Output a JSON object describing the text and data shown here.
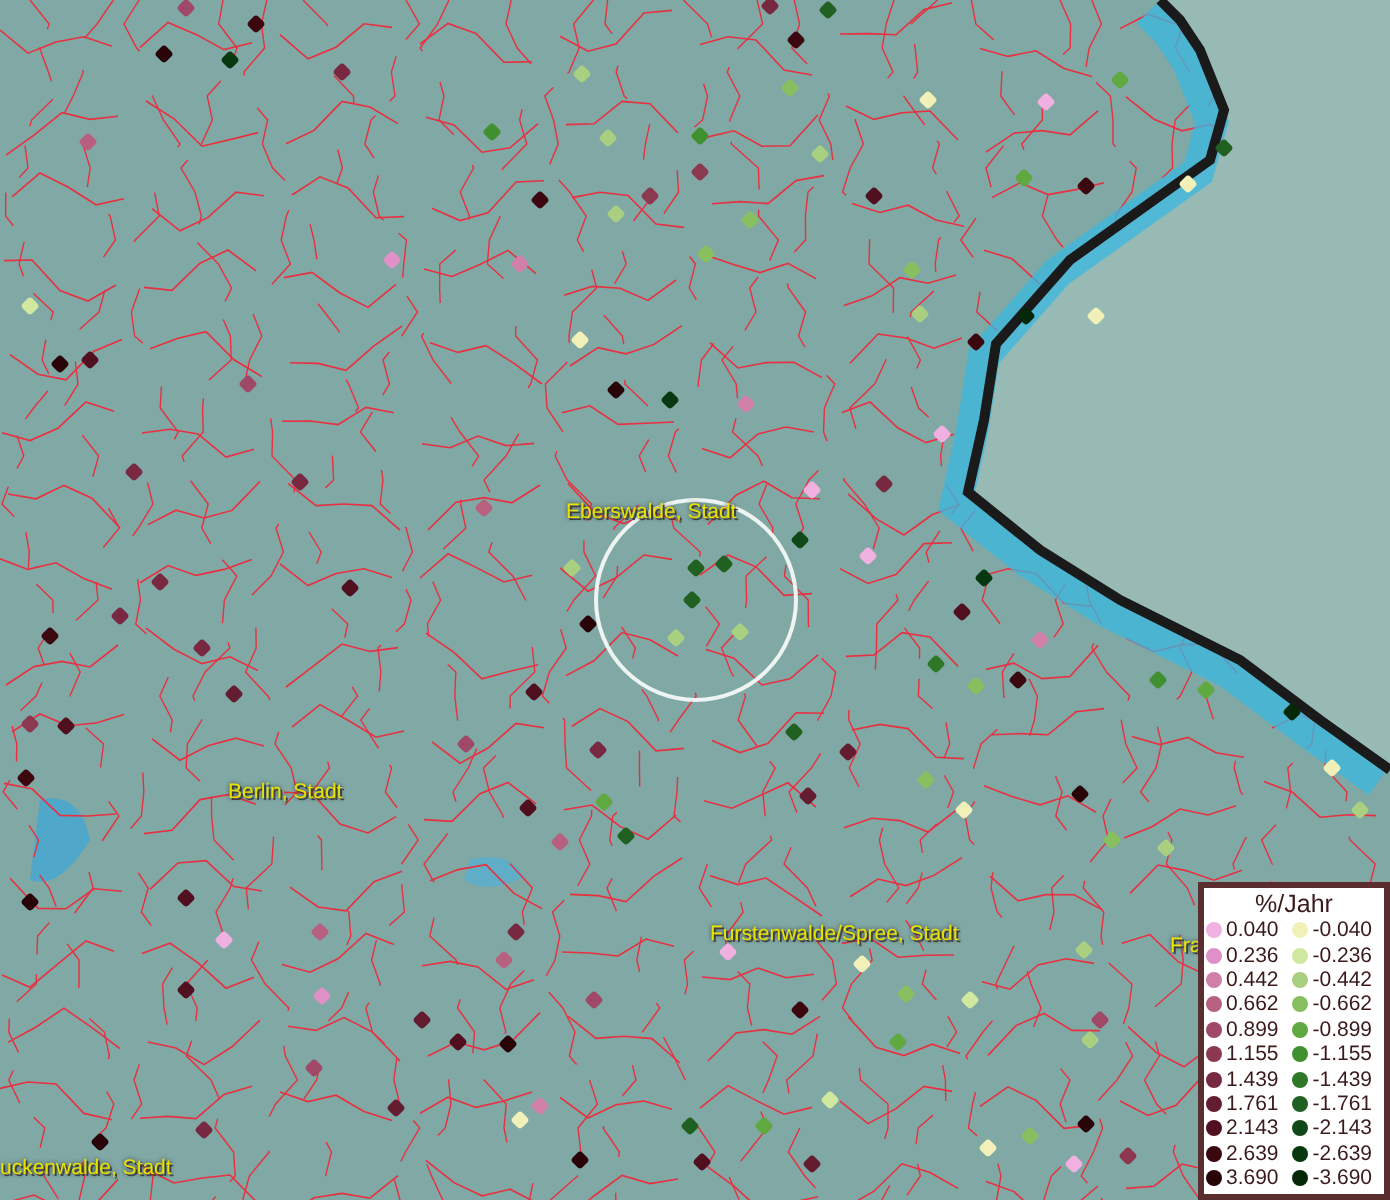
{
  "map": {
    "place_labels": [
      {
        "text": "Eberswalde, Stadt",
        "kind": "city"
      },
      {
        "text": "Berlin, Stadt",
        "kind": "city"
      },
      {
        "text": "Furstenwalde/Spree, Stadt",
        "kind": "city"
      },
      {
        "text": "uckenwalde, Stadt",
        "kind": "city"
      },
      {
        "text": "Fra",
        "kind": "city"
      }
    ]
  },
  "legend": {
    "title": "%/Jahr",
    "positive": [
      {
        "label": "0.040",
        "color": "#f0b0e0"
      },
      {
        "label": "0.236",
        "color": "#e090c8"
      },
      {
        "label": "0.442",
        "color": "#d080a8"
      },
      {
        "label": "0.662",
        "color": "#b86080"
      },
      {
        "label": "0.899",
        "color": "#a04868"
      },
      {
        "label": "1.155",
        "color": "#8c3850"
      },
      {
        "label": "1.439",
        "color": "#782840"
      },
      {
        "label": "1.761",
        "color": "#641c30"
      },
      {
        "label": "2.143",
        "color": "#501020"
      },
      {
        "label": "2.639",
        "color": "#3c0810"
      },
      {
        "label": "3.690",
        "color": "#280408"
      }
    ],
    "negative": [
      {
        "label": "-0.040",
        "color": "#f0f0b8"
      },
      {
        "label": "-0.236",
        "color": "#d0e8a0"
      },
      {
        "label": "-0.442",
        "color": "#a8d080"
      },
      {
        "label": "-0.662",
        "color": "#88c060"
      },
      {
        "label": "-0.899",
        "color": "#60a840"
      },
      {
        "label": "-1.155",
        "color": "#409030"
      },
      {
        "label": "-1.439",
        "color": "#307828"
      },
      {
        "label": "-1.761",
        "color": "#206020"
      },
      {
        "label": "-2.143",
        "color": "#104818"
      },
      {
        "label": "-2.639",
        "color": "#083810"
      },
      {
        "label": "-3.690",
        "color": "#042808"
      }
    ]
  }
}
